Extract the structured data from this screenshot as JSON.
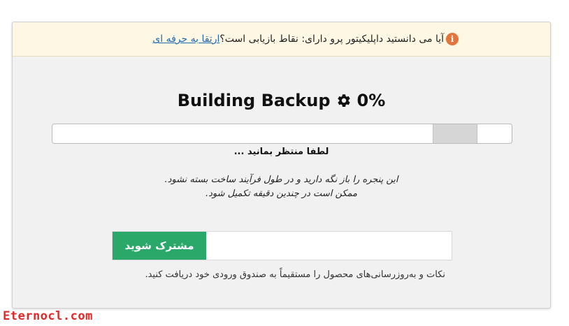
{
  "notice": {
    "icon": "info-icon",
    "text": "آیا می دانستید داپلیکیتور پرو دارای: نقاط بازیابی است؟",
    "link": "ارتقا به حرفه ای"
  },
  "build": {
    "title": "Building Backup",
    "icon": "gear-icon",
    "percent": "0%",
    "progress_value": 0,
    "wait_text": "لطفا منتظر بمانید ...",
    "info_line1": "این پنجره را باز نگه دارید و در طول فرآیند ساخت بسته نشود.",
    "info_line2": "ممکن است در چندین دقیقه تکمیل شود."
  },
  "subscribe": {
    "button_label": "مشترک شوید",
    "input_value": "",
    "description": "نکات و به‌روزرسانی‌های محصول را مستقیماً به صندوق ورودی خود دریافت کنید."
  },
  "watermark": "Eternocl.com",
  "colors": {
    "accent_green": "#2aa86a",
    "notice_bg": "#fdf7e3",
    "info_icon": "#e3743b",
    "link": "#1e69b0",
    "watermark": "#e02a2a"
  }
}
